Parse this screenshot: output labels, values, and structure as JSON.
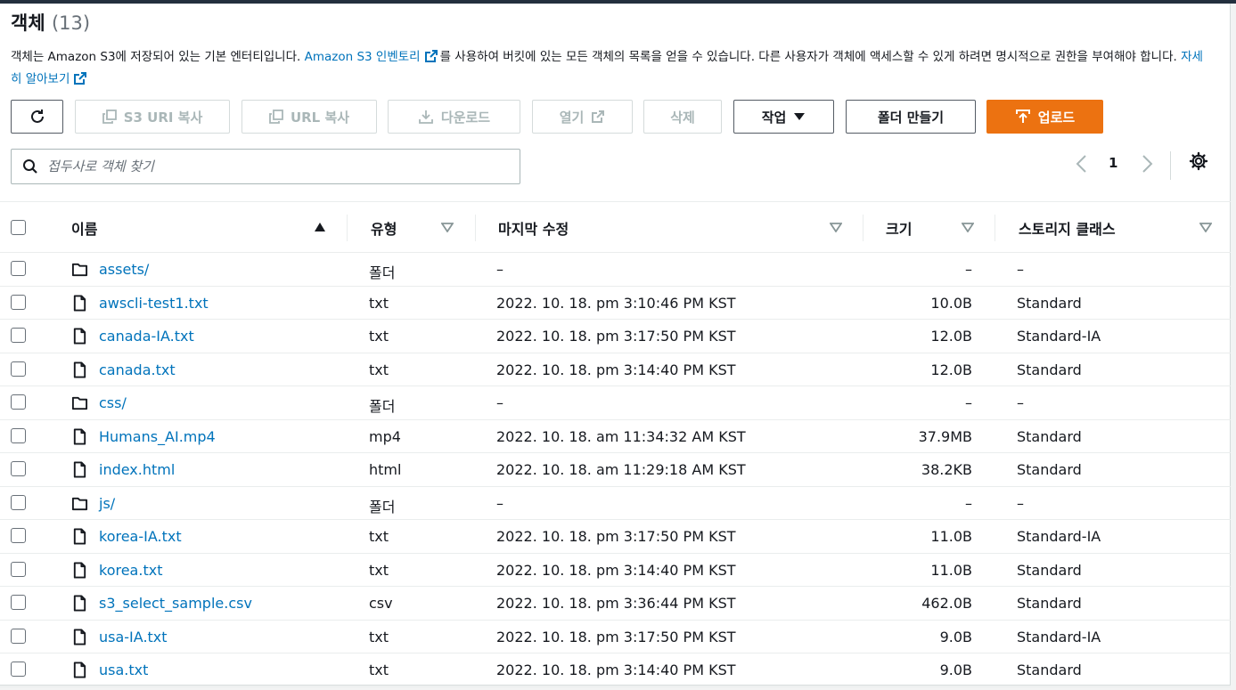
{
  "header": {
    "title": "객체",
    "count": "(13)"
  },
  "description": {
    "part1": "객체는 Amazon S3에 저장되어 있는 기본 엔터티입니다. ",
    "link1": "Amazon S3 인벤토리",
    "part2": "를 사용하여 버킷에 있는 모든 객체의 목록을 얻을 수 있습니다. 다른 사용자가 객체에 액세스할 수 있게 하려면 명시적으로 권한을 부여해야 합니다. ",
    "link2": "자세히 알아보기"
  },
  "toolbar": {
    "refresh_label": "",
    "copy_s3_uri": "S3 URI 복사",
    "copy_url": "URL 복사",
    "download": "다운로드",
    "open": "열기",
    "delete": "삭제",
    "actions": "작업",
    "create_folder": "폴더 만들기",
    "upload": "업로드"
  },
  "search": {
    "placeholder": "접두사로 객체 찾기"
  },
  "pagination": {
    "current_page": "1"
  },
  "columns": {
    "name": "이름",
    "type": "유형",
    "modified": "마지막 수정",
    "size": "크기",
    "storage": "스토리지 클래스"
  },
  "rows": [
    {
      "name": "assets/",
      "kind": "folder",
      "type": "폴더",
      "modified": "–",
      "size": "–",
      "storage": "–"
    },
    {
      "name": "awscli-test1.txt",
      "kind": "file",
      "type": "txt",
      "modified": "2022. 10. 18. pm 3:10:46 PM KST",
      "size": "10.0B",
      "storage": "Standard"
    },
    {
      "name": "canada-IA.txt",
      "kind": "file",
      "type": "txt",
      "modified": "2022. 10. 18. pm 3:17:50 PM KST",
      "size": "12.0B",
      "storage": "Standard-IA"
    },
    {
      "name": "canada.txt",
      "kind": "file",
      "type": "txt",
      "modified": "2022. 10. 18. pm 3:14:40 PM KST",
      "size": "12.0B",
      "storage": "Standard"
    },
    {
      "name": "css/",
      "kind": "folder",
      "type": "폴더",
      "modified": "–",
      "size": "–",
      "storage": "–"
    },
    {
      "name": "Humans_AI.mp4",
      "kind": "file",
      "type": "mp4",
      "modified": "2022. 10. 18. am 11:34:32 AM KST",
      "size": "37.9MB",
      "storage": "Standard"
    },
    {
      "name": "index.html",
      "kind": "file",
      "type": "html",
      "modified": "2022. 10. 18. am 11:29:18 AM KST",
      "size": "38.2KB",
      "storage": "Standard"
    },
    {
      "name": "js/",
      "kind": "folder",
      "type": "폴더",
      "modified": "–",
      "size": "–",
      "storage": "–"
    },
    {
      "name": "korea-IA.txt",
      "kind": "file",
      "type": "txt",
      "modified": "2022. 10. 18. pm 3:17:50 PM KST",
      "size": "11.0B",
      "storage": "Standard-IA"
    },
    {
      "name": "korea.txt",
      "kind": "file",
      "type": "txt",
      "modified": "2022. 10. 18. pm 3:14:40 PM KST",
      "size": "11.0B",
      "storage": "Standard"
    },
    {
      "name": "s3_select_sample.csv",
      "kind": "file",
      "type": "csv",
      "modified": "2022. 10. 18. pm 3:36:44 PM KST",
      "size": "462.0B",
      "storage": "Standard"
    },
    {
      "name": "usa-IA.txt",
      "kind": "file",
      "type": "txt",
      "modified": "2022. 10. 18. pm 3:17:50 PM KST",
      "size": "9.0B",
      "storage": "Standard-IA"
    },
    {
      "name": "usa.txt",
      "kind": "file",
      "type": "txt",
      "modified": "2022. 10. 18. pm 3:14:40 PM KST",
      "size": "9.0B",
      "storage": "Standard"
    }
  ],
  "colors": {
    "link": "#0073bb",
    "primary": "#ec7211",
    "disabled": "#aab7b8",
    "text": "#16191f"
  }
}
